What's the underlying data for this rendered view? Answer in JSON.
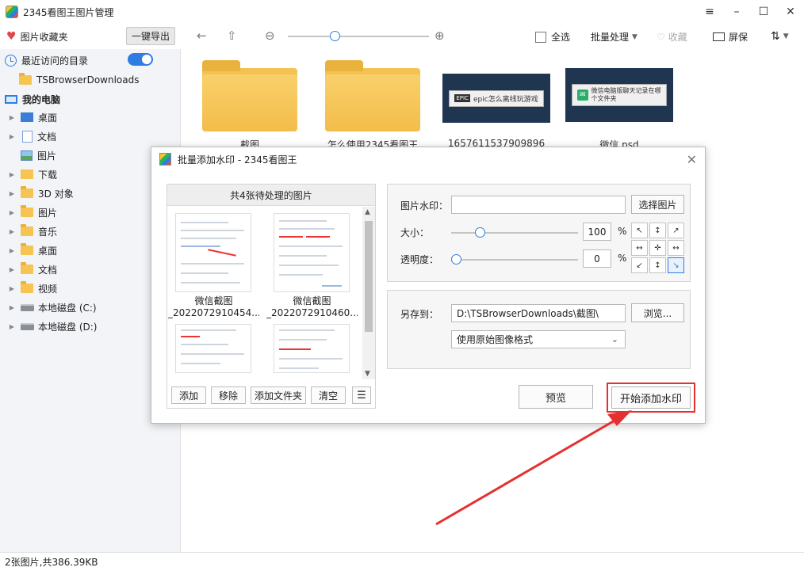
{
  "window": {
    "title": "2345看图王图片管理",
    "controls": {
      "menu": "≡",
      "minimize": "–",
      "maximize": "☐",
      "close": "✕"
    }
  },
  "toolbar": {
    "favorites_label": "图片收藏夹",
    "export_label": "一键导出",
    "select_all_label": "全选",
    "batch_label": "批量处理",
    "collect_label": "收藏",
    "screen_label": "屏保",
    "sort_icon": "⇅",
    "zoom_level": 0.3
  },
  "sidebar": {
    "recent_label": "最近访问的目录",
    "recent_toggle_on": true,
    "recent_items": [
      "TSBrowserDownloads"
    ],
    "pc_label": "我的电脑",
    "pc_items": [
      {
        "label": "桌面",
        "icon": "desktop-icon"
      },
      {
        "label": "文档",
        "icon": "document-icon"
      },
      {
        "label": "图片",
        "icon": "picture-icon"
      },
      {
        "label": "下载",
        "icon": "download-icon"
      },
      {
        "label": "3D 对象",
        "icon": "folder-icon"
      },
      {
        "label": "图片",
        "icon": "folder-icon"
      },
      {
        "label": "音乐",
        "icon": "folder-icon"
      },
      {
        "label": "桌面",
        "icon": "folder-icon"
      },
      {
        "label": "文档",
        "icon": "folder-icon"
      },
      {
        "label": "视频",
        "icon": "folder-icon"
      },
      {
        "label": "本地磁盘 (C:)",
        "icon": "disk-icon"
      },
      {
        "label": "本地磁盘 (D:)",
        "icon": "disk-icon"
      }
    ]
  },
  "main": {
    "thumbnails": [
      {
        "label": "截图",
        "kind": "folder"
      },
      {
        "label": "怎么使用2345看图王",
        "kind": "folder"
      },
      {
        "label": "1657611537909896",
        "kind": "image",
        "chip": "epic怎么离线玩游戏"
      },
      {
        "label": "微信.psd",
        "kind": "image",
        "chip": "微信电脑版聊天记录在哪个文件夹"
      }
    ]
  },
  "status": {
    "text": "2张图片,共386.39KB"
  },
  "dialog": {
    "title": "批量添加水印 - 2345看图王",
    "list_header": "共4张待处理的图片",
    "files": [
      {
        "caption_line1": "微信截图",
        "caption_line2": "_2022072910454..."
      },
      {
        "caption_line1": "微信截图",
        "caption_line2": "_2022072910460..."
      }
    ],
    "list_buttons": {
      "add": "添加",
      "remove": "移除",
      "add_folder": "添加文件夹",
      "clear": "清空",
      "view_icon": "☰"
    },
    "watermark_label": "图片水印：",
    "watermark_value": "",
    "choose_image_label": "选择图片",
    "size_label": "大小：",
    "size_value": "100",
    "opacity_label": "透明度：",
    "opacity_value": "0",
    "percent_sign": "%",
    "position_grid": [
      "↖",
      "↕",
      "↗",
      "↔",
      "✛",
      "↔",
      "↙",
      "↕",
      "↘"
    ],
    "selected_position_index": 8,
    "save_to_label": "另存到：",
    "save_path": "D:\\TSBrowserDownloads\\截图\\",
    "browse_label": "浏览...",
    "format_value": "使用原始图像格式",
    "preview_label": "预览",
    "start_label": "开始添加水印"
  },
  "colors": {
    "accent": "#2f7de1",
    "highlight_red": "#e53030",
    "folder": "#f4c252",
    "sidebar_bg": "#f2f4f7"
  }
}
